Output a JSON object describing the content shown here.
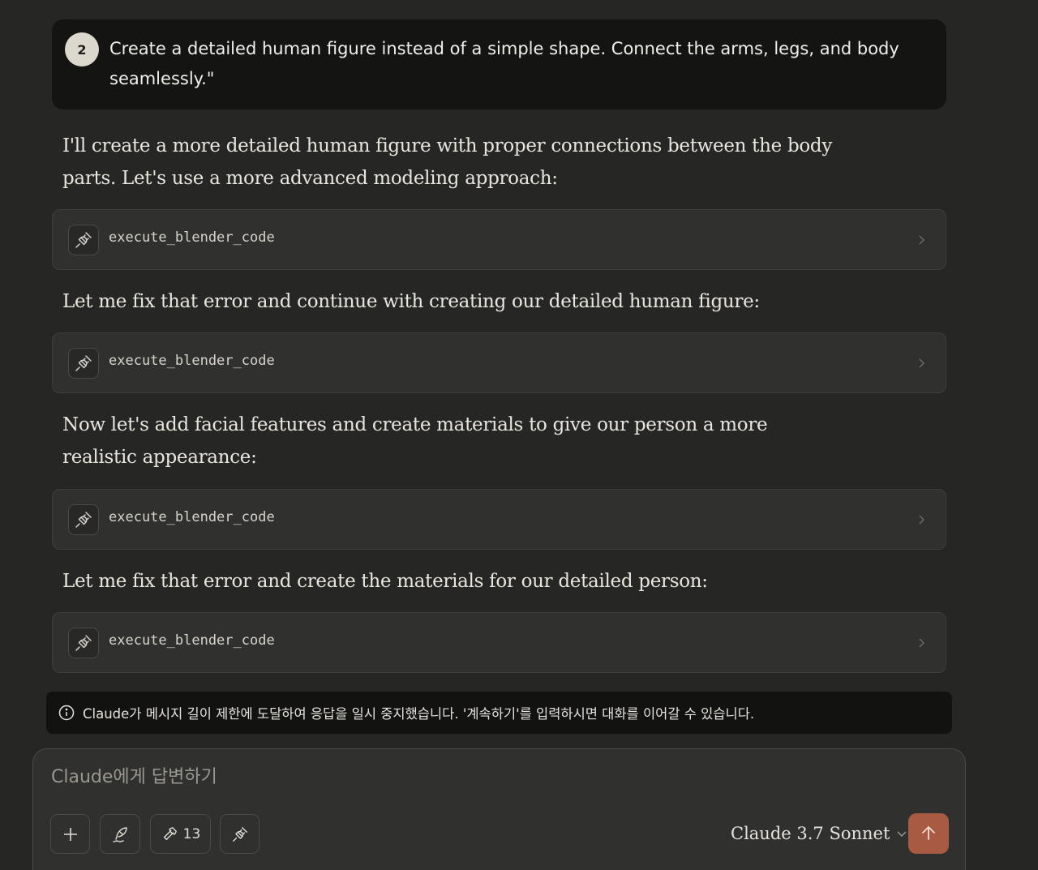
{
  "user_message": {
    "avatar_number": "2",
    "text": "Create a detailed human figure instead of a simple shape. Connect the arms, legs, and body seamlessly.\""
  },
  "assistant": {
    "paragraph_1": "I'll create a more detailed human figure with proper connections between the body parts. Let's use a more advanced modeling approach:",
    "paragraph_2": "Let me fix that error and continue with creating our detailed human figure:",
    "paragraph_3": "Now let's add facial features and create materials to give our person a more realistic appearance:",
    "paragraph_4": "Let me fix that error and create the materials for our detailed person:",
    "tool_calls": [
      {
        "label": "execute_blender_code",
        "icon": "plug-icon"
      },
      {
        "label": "execute_blender_code",
        "icon": "plug-icon"
      },
      {
        "label": "execute_blender_code",
        "icon": "plug-icon"
      },
      {
        "label": "execute_blender_code",
        "icon": "plug-icon"
      }
    ]
  },
  "notice": {
    "icon": "info-icon",
    "text": "Claude가 메시지 길이 제한에 도달하여 응답을 일시 중지했습니다. '계속하기'를 입력하시면 대화를 이어갈 수 있습니다."
  },
  "composer": {
    "placeholder": "Claude에게 답변하기",
    "tools_count": "13",
    "model_name": "Claude 3.7 Sonnet",
    "send_color": "#a85a42"
  }
}
